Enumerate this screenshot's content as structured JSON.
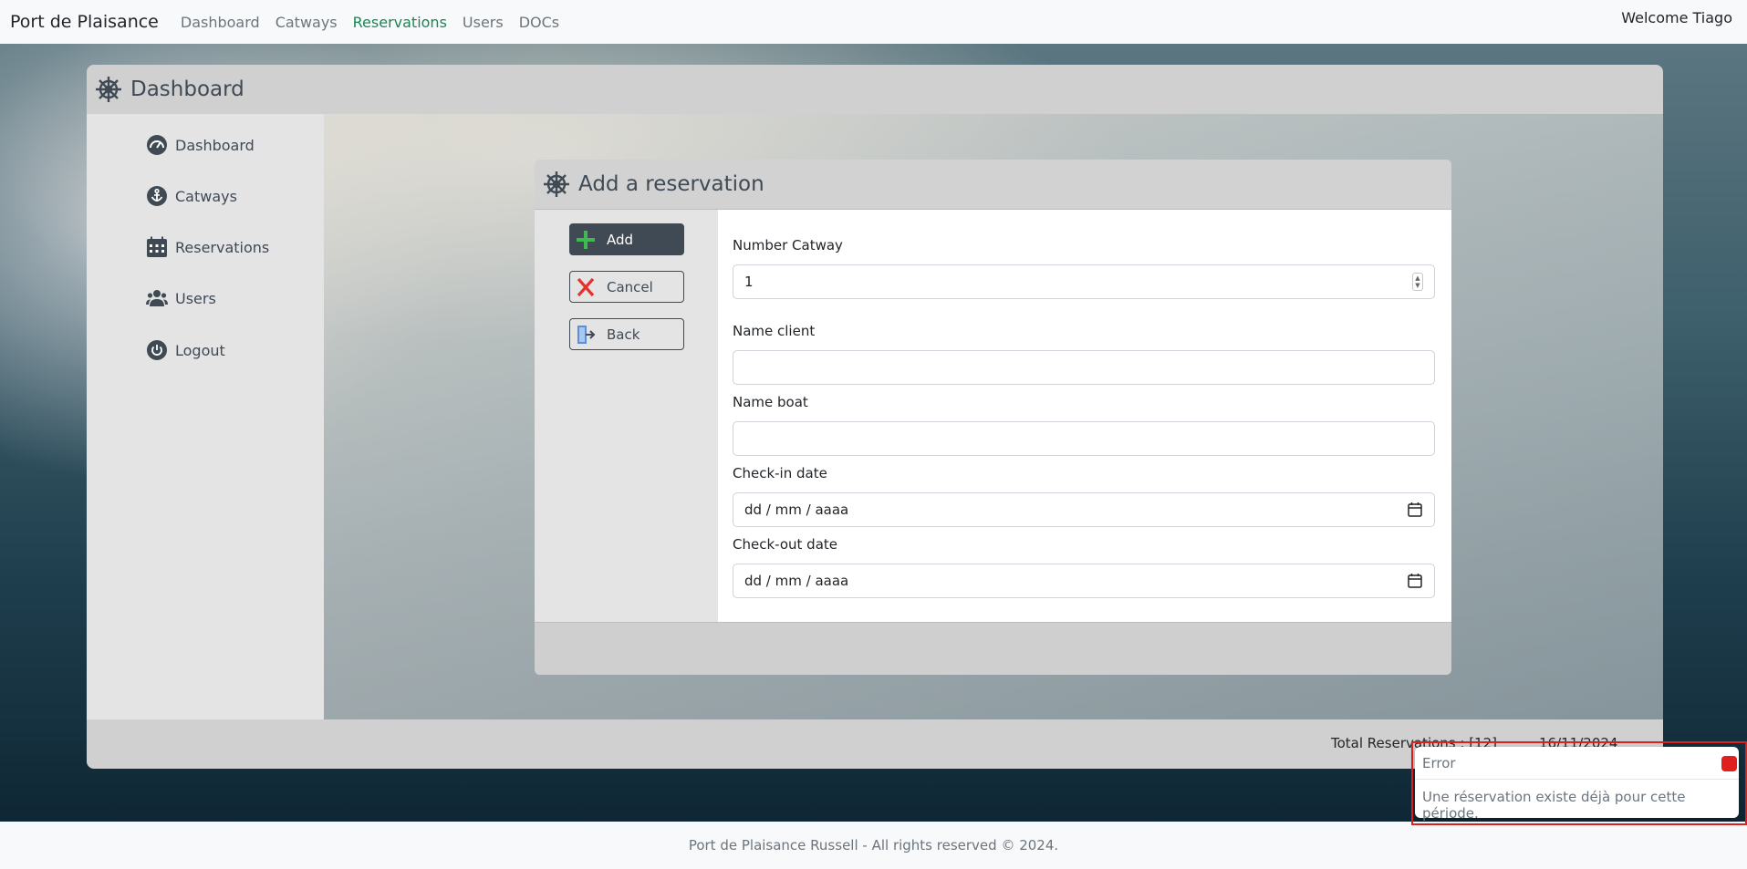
{
  "navbar": {
    "brand": "Port de Plaisance",
    "links": [
      "Dashboard",
      "Catways",
      "Reservations",
      "Users",
      "DOCs"
    ],
    "active": "Reservations",
    "welcome": "Welcome Tiago"
  },
  "dashboard": {
    "title": "Dashboard",
    "sidebar": [
      {
        "label": "Dashboard",
        "icon": "dashboard-gauge-icon"
      },
      {
        "label": "Catways",
        "icon": "anchor-icon"
      },
      {
        "label": "Reservations",
        "icon": "calendar-icon"
      },
      {
        "label": "Users",
        "icon": "users-icon"
      },
      {
        "label": "Logout",
        "icon": "power-icon"
      }
    ],
    "footer": {
      "total": "Total Reservations : [12]",
      "date": "16/11/2024"
    }
  },
  "form": {
    "title": "Add a reservation",
    "buttons": {
      "add": "Add",
      "cancel": "Cancel",
      "back": "Back"
    },
    "fields": {
      "catway_label": "Number Catway",
      "catway_value": "1",
      "client_label": "Name client",
      "client_value": "",
      "boat_label": "Name boat",
      "boat_value": "",
      "checkin_label": "Check-in date",
      "checkin_value": "dd / mm / aaaa",
      "checkout_label": "Check-out date",
      "checkout_value": "dd / mm / aaaa"
    }
  },
  "site_footer": "Port de Plaisance Russell - All rights reserved © 2024.",
  "toast": {
    "title": "Error",
    "message": "Une réservation existe déjà pour cette période."
  },
  "colors": {
    "active_nav": "#198754",
    "primary_dark": "#3f4a55",
    "error_red": "#e01f1f",
    "add_green": "#3fb950",
    "cancel_red": "#e5322d"
  }
}
